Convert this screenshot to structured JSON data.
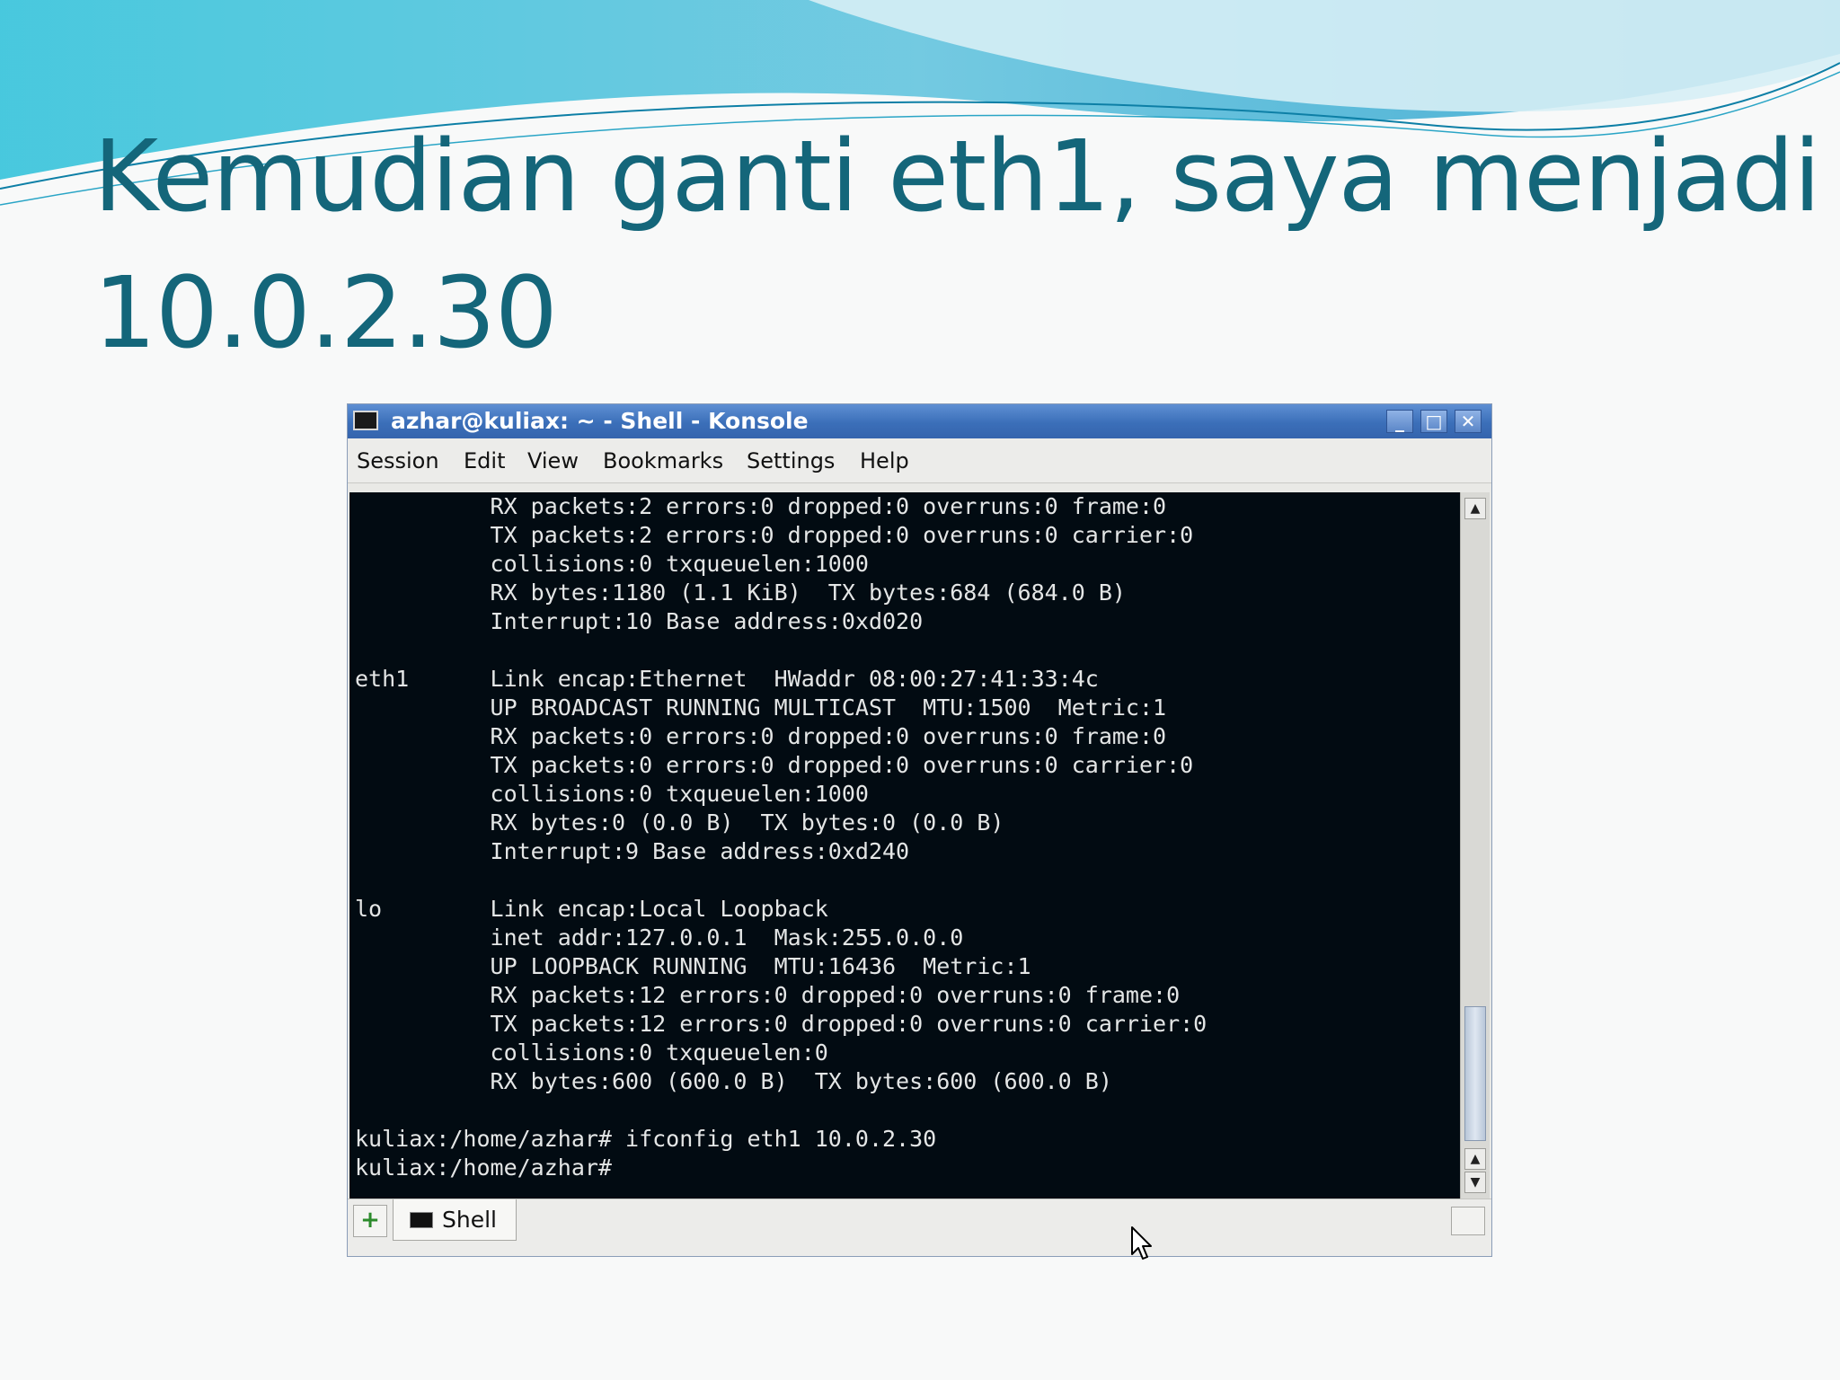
{
  "slide": {
    "title_line1": "Kemudian ganti eth1, saya menjadi",
    "title_line2": "10.0.2.30"
  },
  "window": {
    "title": "azhar@kuliax: ~ - Shell - Konsole",
    "buttons": {
      "minimize": "_",
      "maximize": "□",
      "close": "✕"
    }
  },
  "menu": {
    "items": [
      "Session",
      "Edit",
      "View",
      "Bookmarks",
      "Settings",
      "Help"
    ]
  },
  "terminal": {
    "lines": [
      "          RX packets:2 errors:0 dropped:0 overruns:0 frame:0",
      "          TX packets:2 errors:0 dropped:0 overruns:0 carrier:0",
      "          collisions:0 txqueuelen:1000",
      "          RX bytes:1180 (1.1 KiB)  TX bytes:684 (684.0 B)",
      "          Interrupt:10 Base address:0xd020",
      "",
      "eth1      Link encap:Ethernet  HWaddr 08:00:27:41:33:4c",
      "          UP BROADCAST RUNNING MULTICAST  MTU:1500  Metric:1",
      "          RX packets:0 errors:0 dropped:0 overruns:0 frame:0",
      "          TX packets:0 errors:0 dropped:0 overruns:0 carrier:0",
      "          collisions:0 txqueuelen:1000",
      "          RX bytes:0 (0.0 B)  TX bytes:0 (0.0 B)",
      "          Interrupt:9 Base address:0xd240",
      "",
      "lo        Link encap:Local Loopback",
      "          inet addr:127.0.0.1  Mask:255.0.0.0",
      "          UP LOOPBACK RUNNING  MTU:16436  Metric:1",
      "          RX packets:12 errors:0 dropped:0 overruns:0 frame:0",
      "          TX packets:12 errors:0 dropped:0 overruns:0 carrier:0",
      "          collisions:0 txqueuelen:0",
      "          RX bytes:600 (600.0 B)  TX bytes:600 (600.0 B)",
      "",
      "kuliax:/home/azhar# ifconfig eth1 10.0.2.30",
      "kuliax:/home/azhar#"
    ]
  },
  "scrollbar": {
    "up": "▲",
    "down": "▼"
  },
  "tabs": {
    "new_tab": "+",
    "items": [
      {
        "label": "Shell"
      }
    ]
  },
  "colors": {
    "title_text": "#14667a",
    "terminal_bg": "#020b12",
    "terminal_text": "#e4e6e6",
    "titlebar": "#3b6fb9"
  }
}
